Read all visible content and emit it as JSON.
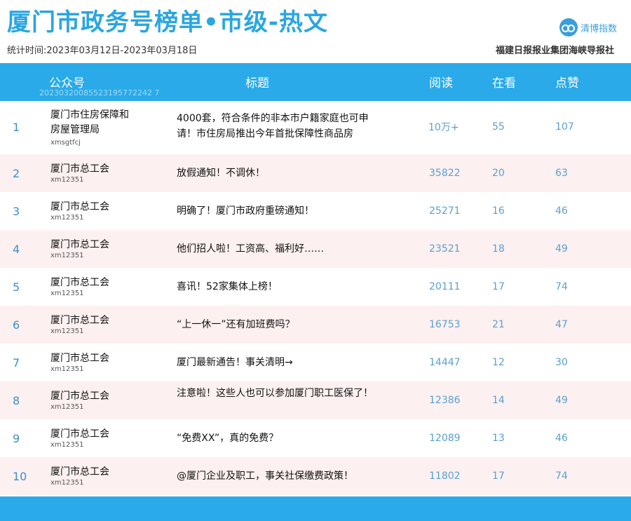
{
  "title": "厦门市政务号榜单•市级-热文",
  "subtitle": "统计时间:2023年03月12日-2023年03月18日",
  "logo_text": "清博指数",
  "org": "福建日报报业集团海峡导报社",
  "watermark": "20230320085523195772242 7",
  "columns": {
    "account": "公众号",
    "title": "标题",
    "reads": "阅读",
    "watching": "在看",
    "likes": "点赞"
  },
  "rows": [
    {
      "rank": "1",
      "account": "厦门市住房保障和房屋管理局",
      "account_id": "xmsgtfcj",
      "title": "4000套，符合条件的非本市户籍家庭也可申请！市住房局推出今年首批保障性商品房",
      "reads": "10万+",
      "watching": "55",
      "likes": "107"
    },
    {
      "rank": "2",
      "account": "厦门市总工会",
      "account_id": "xm12351",
      "title": "放假通知！不调休！",
      "reads": "35822",
      "watching": "20",
      "likes": "63"
    },
    {
      "rank": "3",
      "account": "厦门市总工会",
      "account_id": "xm12351",
      "title": "明确了！厦门市政府重磅通知！",
      "reads": "25271",
      "watching": "16",
      "likes": "46"
    },
    {
      "rank": "4",
      "account": "厦门市总工会",
      "account_id": "xm12351",
      "title": "他们招人啦！工资高、福利好……",
      "reads": "23521",
      "watching": "18",
      "likes": "49"
    },
    {
      "rank": "5",
      "account": "厦门市总工会",
      "account_id": "xm12351",
      "title": "喜讯！52家集体上榜！",
      "reads": "20111",
      "watching": "17",
      "likes": "74"
    },
    {
      "rank": "6",
      "account": "厦门市总工会",
      "account_id": "xm12351",
      "title": "“上一休一”还有加班费吗？",
      "reads": "16753",
      "watching": "21",
      "likes": "47"
    },
    {
      "rank": "7",
      "account": "厦门市总工会",
      "account_id": "xm12351",
      "title": "厦门最新通告！事关清明→",
      "reads": "14447",
      "watching": "12",
      "likes": "30"
    },
    {
      "rank": "8",
      "account": "厦门市总工会",
      "account_id": "xm12351",
      "title": "注意啦！这些人也可以参加厦门职工医保了！",
      "reads": "12386",
      "watching": "14",
      "likes": "49"
    },
    {
      "rank": "9",
      "account": "厦门市总工会",
      "account_id": "xm12351",
      "title": "“免费XX”，真的免费？",
      "reads": "12089",
      "watching": "13",
      "likes": "46"
    },
    {
      "rank": "10",
      "account": "厦门市总工会",
      "account_id": "xm12351",
      "title": "@厦门企业及职工，事关社保缴费政策！",
      "reads": "11802",
      "watching": "17",
      "likes": "74"
    }
  ]
}
